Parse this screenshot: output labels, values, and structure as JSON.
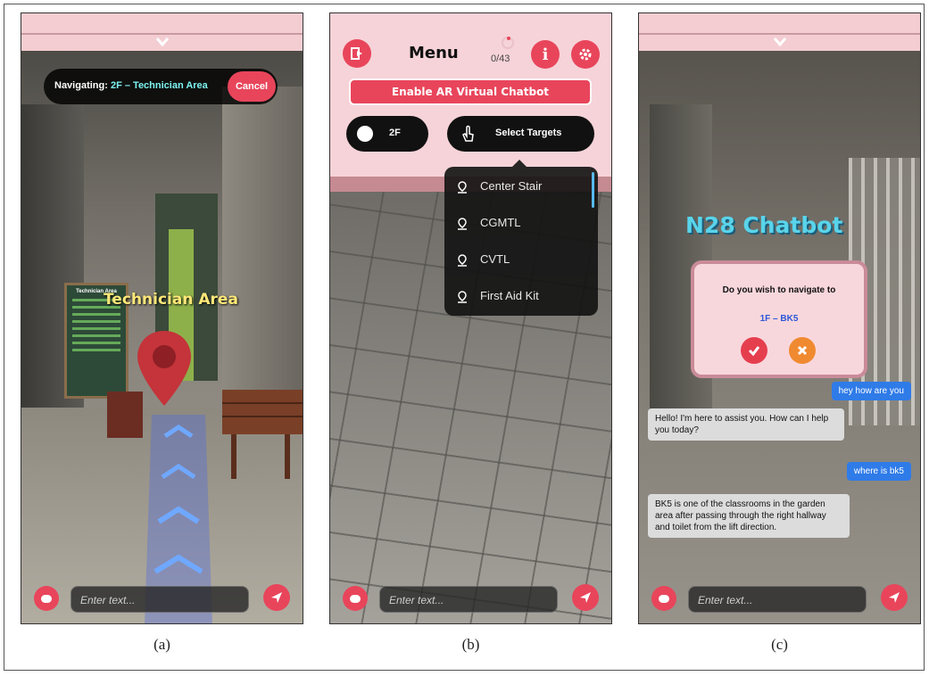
{
  "panels": {
    "a": {
      "caption": "(a)",
      "nav_prefix": "Navigating:",
      "nav_destination": "2F – Technician Area",
      "cancel_label": "Cancel",
      "ar_label": "Technician Area",
      "board_title": "Technician Area",
      "input_placeholder": "Enter text..."
    },
    "b": {
      "caption": "(b)",
      "menu_title": "Menu",
      "progress": "0/43",
      "ar_chatbot_button": "Enable AR Virtual Chatbot",
      "floor_value": "2F",
      "targets_button": "Select Targets",
      "dropdown_items": [
        "Center Stair",
        "CGMTL",
        "CVTL",
        "First Aid Kit"
      ],
      "input_placeholder": "Enter text..."
    },
    "c": {
      "caption": "(c)",
      "bot_title": "N28 Chatbot",
      "dialog_question": "Do you wish to navigate to",
      "dialog_destination": "1F – BK5",
      "messages": [
        {
          "role": "user",
          "text": "hey how are you"
        },
        {
          "role": "bot",
          "text": "Hello! I'm here to assist you. How can I help you today?"
        },
        {
          "role": "user",
          "text": "where is bk5"
        },
        {
          "role": "bot",
          "text": "BK5 is one of the classrooms in the garden area after passing through the right hallway and toilet from the lift direction."
        }
      ],
      "input_placeholder": "Enter text..."
    }
  },
  "colors": {
    "accent": "#e8455b",
    "panel_pink": "#f6d3d8",
    "nav_cyan": "#7cf3f0",
    "bot_title": "#59d4ea",
    "user_bubble": "#2f7be8",
    "bot_bubble": "#dcdcdc"
  },
  "icons": [
    "chevron-down-icon",
    "chat-icon",
    "send-icon",
    "exit-icon",
    "info-icon",
    "gear-icon",
    "floor-icon",
    "touch-icon",
    "map-pin-icon",
    "check-icon",
    "close-icon"
  ]
}
